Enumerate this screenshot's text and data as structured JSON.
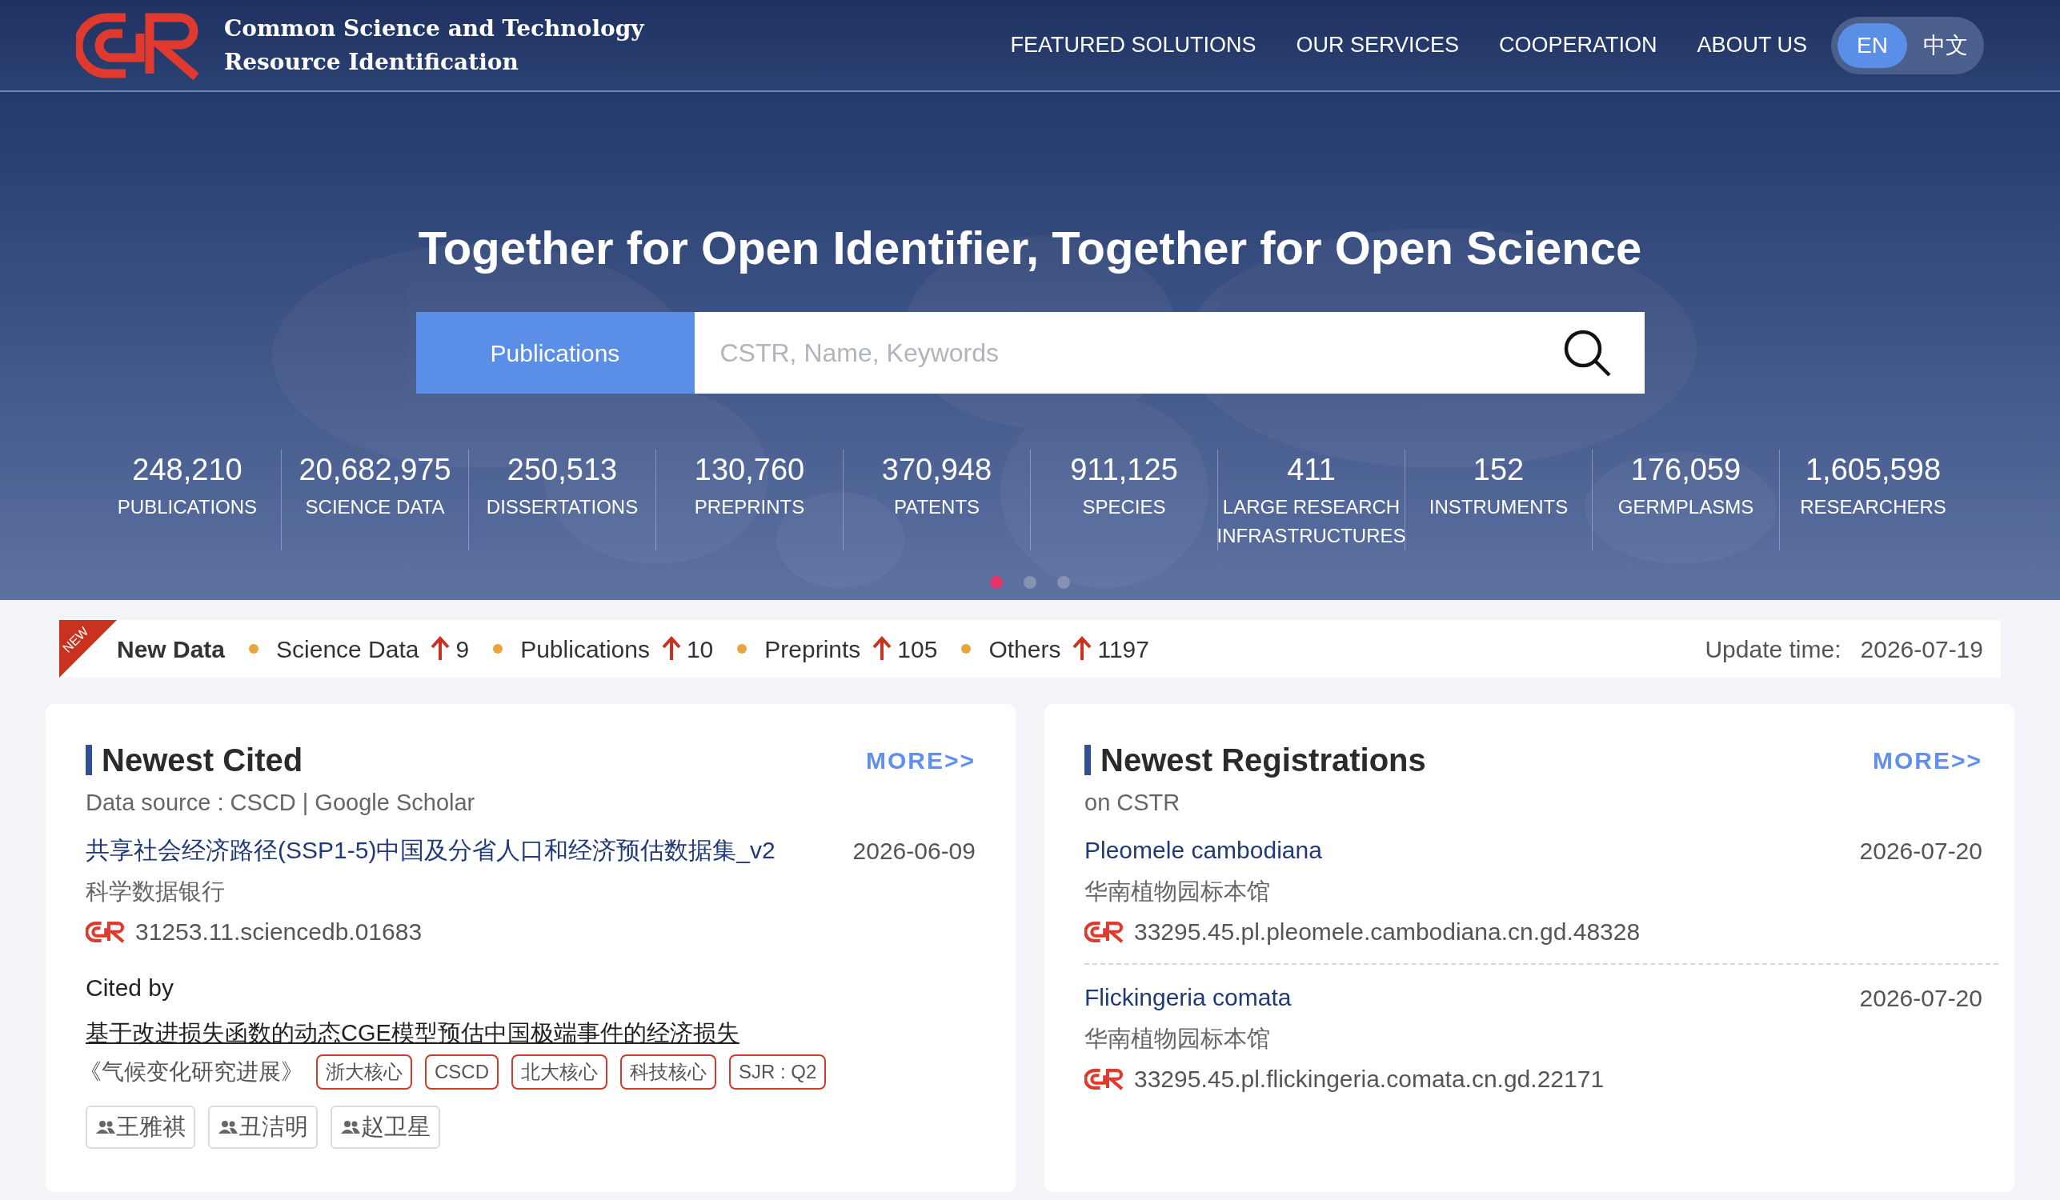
{
  "header": {
    "site_title_lines": [
      "Common Science and Technology",
      "Resource Identification"
    ],
    "nav": [
      "FEATURED SOLUTIONS",
      "OUR SERVICES",
      "COOPERATION",
      "ABOUT US"
    ],
    "languages": [
      {
        "label": "EN",
        "selected": true
      },
      {
        "label": "中文",
        "selected": false
      }
    ]
  },
  "hero": {
    "headline": "Together for Open Identifier, Together for Open Science",
    "search": {
      "category": "Publications",
      "placeholder": "CSTR, Name, Keywords"
    },
    "stats": [
      {
        "value": "248,210",
        "label": "PUBLICATIONS"
      },
      {
        "value": "20,682,975",
        "label": "SCIENCE DATA"
      },
      {
        "value": "250,513",
        "label": "DISSERTATIONS"
      },
      {
        "value": "130,760",
        "label": "PREPRINTS"
      },
      {
        "value": "370,948",
        "label": "PATENTS"
      },
      {
        "value": "911,125",
        "label": "SPECIES"
      },
      {
        "value": "411",
        "label": "LARGE RESEARCH INFRASTRUCTURES"
      },
      {
        "value": "152",
        "label": "INSTRUMENTS"
      },
      {
        "value": "176,059",
        "label": "GERMPLASMS"
      },
      {
        "value": "1,605,598",
        "label": "RESEARCHERS"
      }
    ],
    "carousel_dots": [
      {
        "selected": true
      },
      {
        "selected": false
      },
      {
        "selected": false
      }
    ]
  },
  "new_data": {
    "badge": "NEW",
    "title": "New Data",
    "items": [
      {
        "label": "Science Data",
        "count": "9"
      },
      {
        "label": "Publications",
        "count": "10"
      },
      {
        "label": "Preprints",
        "count": "105"
      },
      {
        "label": "Others",
        "count": "1197"
      }
    ],
    "update_label": "Update time:",
    "update_value": "2026-07-19"
  },
  "newest_cited": {
    "title": "Newest Cited",
    "more": "MORE>>",
    "source": "Data source : CSCD | Google Scholar",
    "entries": [
      {
        "title": "共享社会经济路径(SSP1-5)中国及分省人口和经济预估数据集_v2",
        "date": "2026-06-09",
        "publisher": "科学数据银行",
        "cstr": "31253.11.sciencedb.01683"
      }
    ],
    "cited_by_label": "Cited by",
    "citation": {
      "title": "基于改进损失函数的动态CGE模型预估中国极端事件的经济损失",
      "journal": "《气候变化研究进展》",
      "tags": [
        "浙大核心",
        "CSCD",
        "北大核心",
        "科技核心",
        "SJR : Q2"
      ],
      "authors": [
        "王雅祺",
        "丑洁明",
        "赵卫星"
      ]
    }
  },
  "newest_registrations": {
    "title": "Newest Registrations",
    "more": "MORE>>",
    "subtitle": "on CSTR",
    "entries": [
      {
        "title": "Pleomele cambodiana",
        "date": "2026-07-20",
        "publisher": "华南植物园标本馆",
        "cstr": "33295.45.pl.pleomele.cambodiana.cn.gd.48328"
      },
      {
        "title": "Flickingeria comata",
        "date": "2026-07-20",
        "publisher": "华南植物园标本馆",
        "cstr": "33295.45.pl.flickingeria.comata.cn.gd.22171"
      }
    ]
  }
}
